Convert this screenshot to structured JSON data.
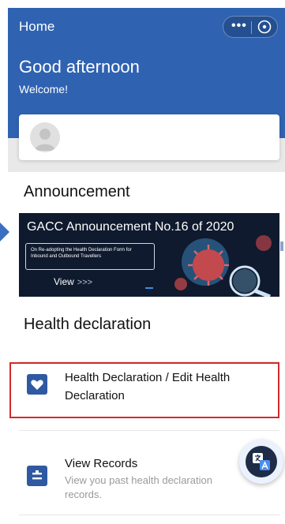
{
  "header": {
    "title": "Home",
    "greeting": "Good afternoon",
    "welcome": "Welcome!"
  },
  "announcement": {
    "section_title": "Announcement",
    "banner_heading": "GACC Announcement No.16 of 2020",
    "banner_text": "On Re-adopting the Health Declaration Form for Inbound and Outbound Travellers",
    "view_label": "View",
    "view_arrows": ">>>"
  },
  "health": {
    "section_title": "Health declaration",
    "items": [
      {
        "title": "Health Declaration / Edit Health Declaration",
        "icon": "heart-icon"
      },
      {
        "title": "View Records",
        "subtitle": "View you past health declaration records.",
        "icon": "records-icon"
      }
    ]
  },
  "colors": {
    "header_bg": "#2f63b1",
    "icon_bg": "#2f5aa1",
    "highlight": "#d22a2a"
  }
}
